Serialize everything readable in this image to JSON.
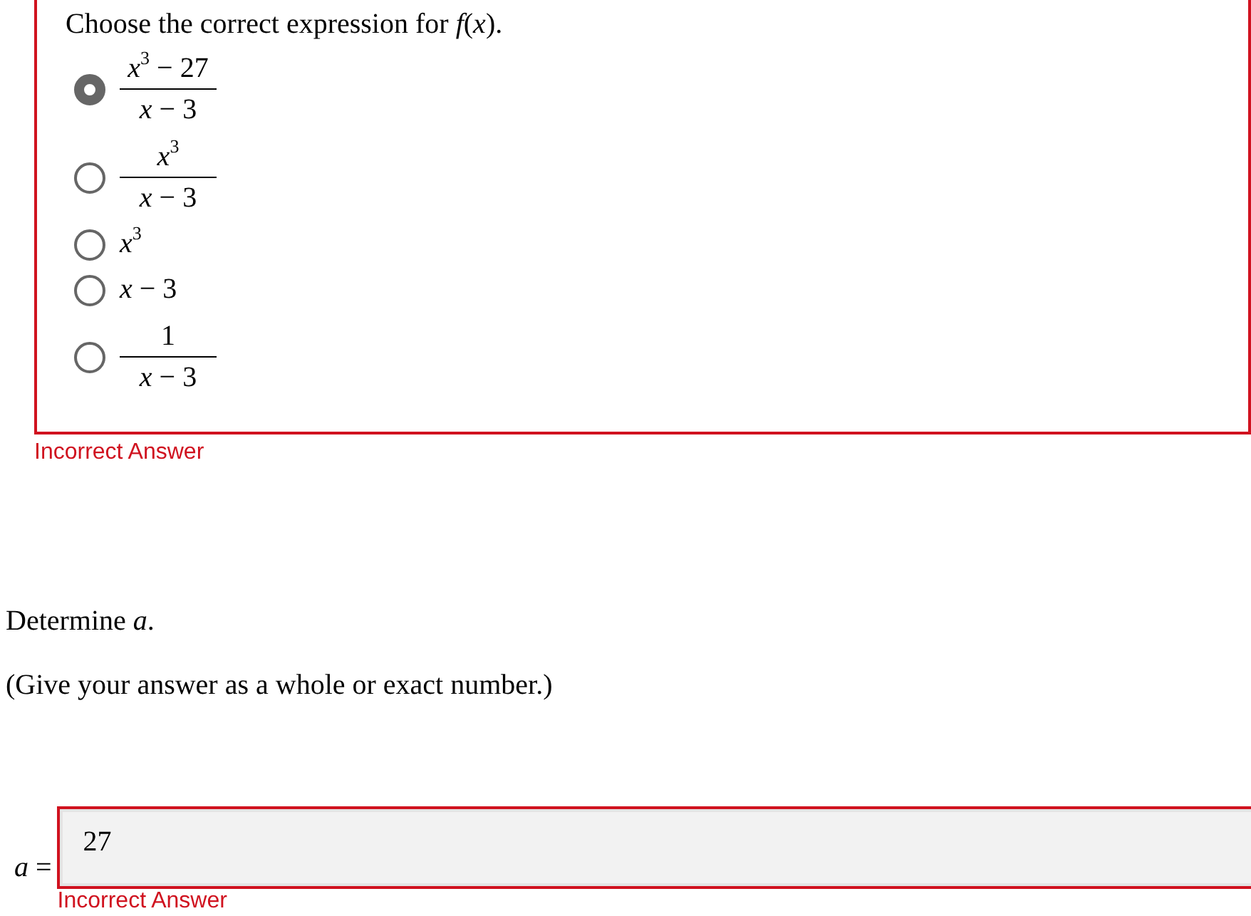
{
  "question_1": {
    "prompt": "Choose the correct expression for *f*(*x*).",
    "correct": false,
    "options": [
      {
        "kind": "fraction",
        "numerator": "*x*$^{3}$ − 27",
        "denominator": "*x* − 3",
        "selected": true
      },
      {
        "kind": "fraction",
        "numerator": "*x*$^{3}$",
        "denominator": "*x* − 3",
        "selected": false
      },
      {
        "kind": "inline",
        "expression": "*x*$^{3}$",
        "selected": false
      },
      {
        "kind": "inline",
        "expression": "*x* − 3",
        "selected": false
      },
      {
        "kind": "fraction",
        "numerator": "1",
        "denominator": "*x* − 3",
        "selected": false
      }
    ],
    "feedback": "Incorrect Answer"
  },
  "question_2": {
    "prompt": "Determine *a*.",
    "instruction": "(Give your answer as a whole or exact number.)",
    "correct": false,
    "answer": {
      "label": "*a* =",
      "value": "27"
    },
    "feedback": "Incorrect Answer"
  }
}
